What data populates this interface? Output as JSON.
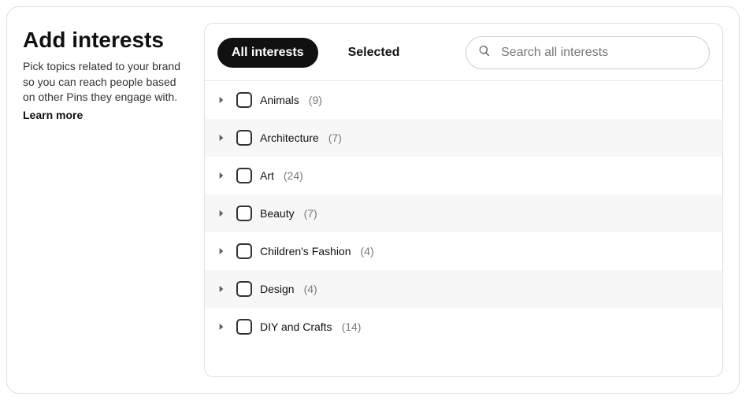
{
  "left": {
    "title": "Add interests",
    "description": "Pick topics related to your brand so you can reach people based on other Pins they engage with.",
    "learn_more": "Learn more"
  },
  "tabs": {
    "all": "All interests",
    "selected": "Selected"
  },
  "search": {
    "placeholder": "Search all interests"
  },
  "interests": [
    {
      "label": "Animals",
      "count": "(9)"
    },
    {
      "label": "Architecture",
      "count": "(7)"
    },
    {
      "label": "Art",
      "count": "(24)"
    },
    {
      "label": "Beauty",
      "count": "(7)"
    },
    {
      "label": "Children's Fashion",
      "count": "(4)"
    },
    {
      "label": "Design",
      "count": "(4)"
    },
    {
      "label": "DIY and Crafts",
      "count": "(14)"
    }
  ]
}
